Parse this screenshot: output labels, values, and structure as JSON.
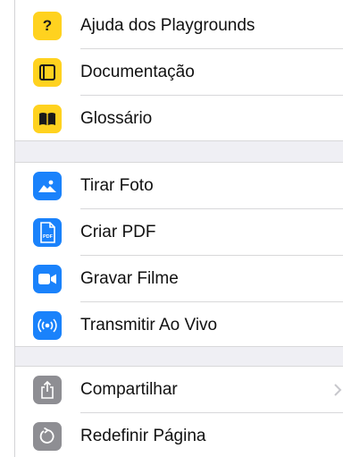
{
  "groups": [
    {
      "items": [
        {
          "label": "Ajuda dos Playgrounds",
          "icon": "help-icon",
          "color": "#ffd21f"
        },
        {
          "label": "Documentação",
          "icon": "documentation-icon",
          "color": "#ffd21f"
        },
        {
          "label": "Glossário",
          "icon": "book-icon",
          "color": "#ffd21f"
        }
      ]
    },
    {
      "items": [
        {
          "label": "Tirar Foto",
          "icon": "photo-icon",
          "color": "#1a82fb"
        },
        {
          "label": "Criar PDF",
          "icon": "pdf-icon",
          "color": "#1a82fb"
        },
        {
          "label": "Gravar Filme",
          "icon": "video-camera-icon",
          "color": "#1a82fb"
        },
        {
          "label": "Transmitir Ao Vivo",
          "icon": "broadcast-icon",
          "color": "#1a82fb"
        }
      ]
    },
    {
      "items": [
        {
          "label": "Compartilhar",
          "icon": "share-icon",
          "color": "#8e8e93",
          "has_chevron": true
        },
        {
          "label": "Redefinir Página",
          "icon": "reset-icon",
          "color": "#8e8e93"
        }
      ]
    }
  ],
  "help_glyph": "?",
  "pdf_glyph": "PDF"
}
